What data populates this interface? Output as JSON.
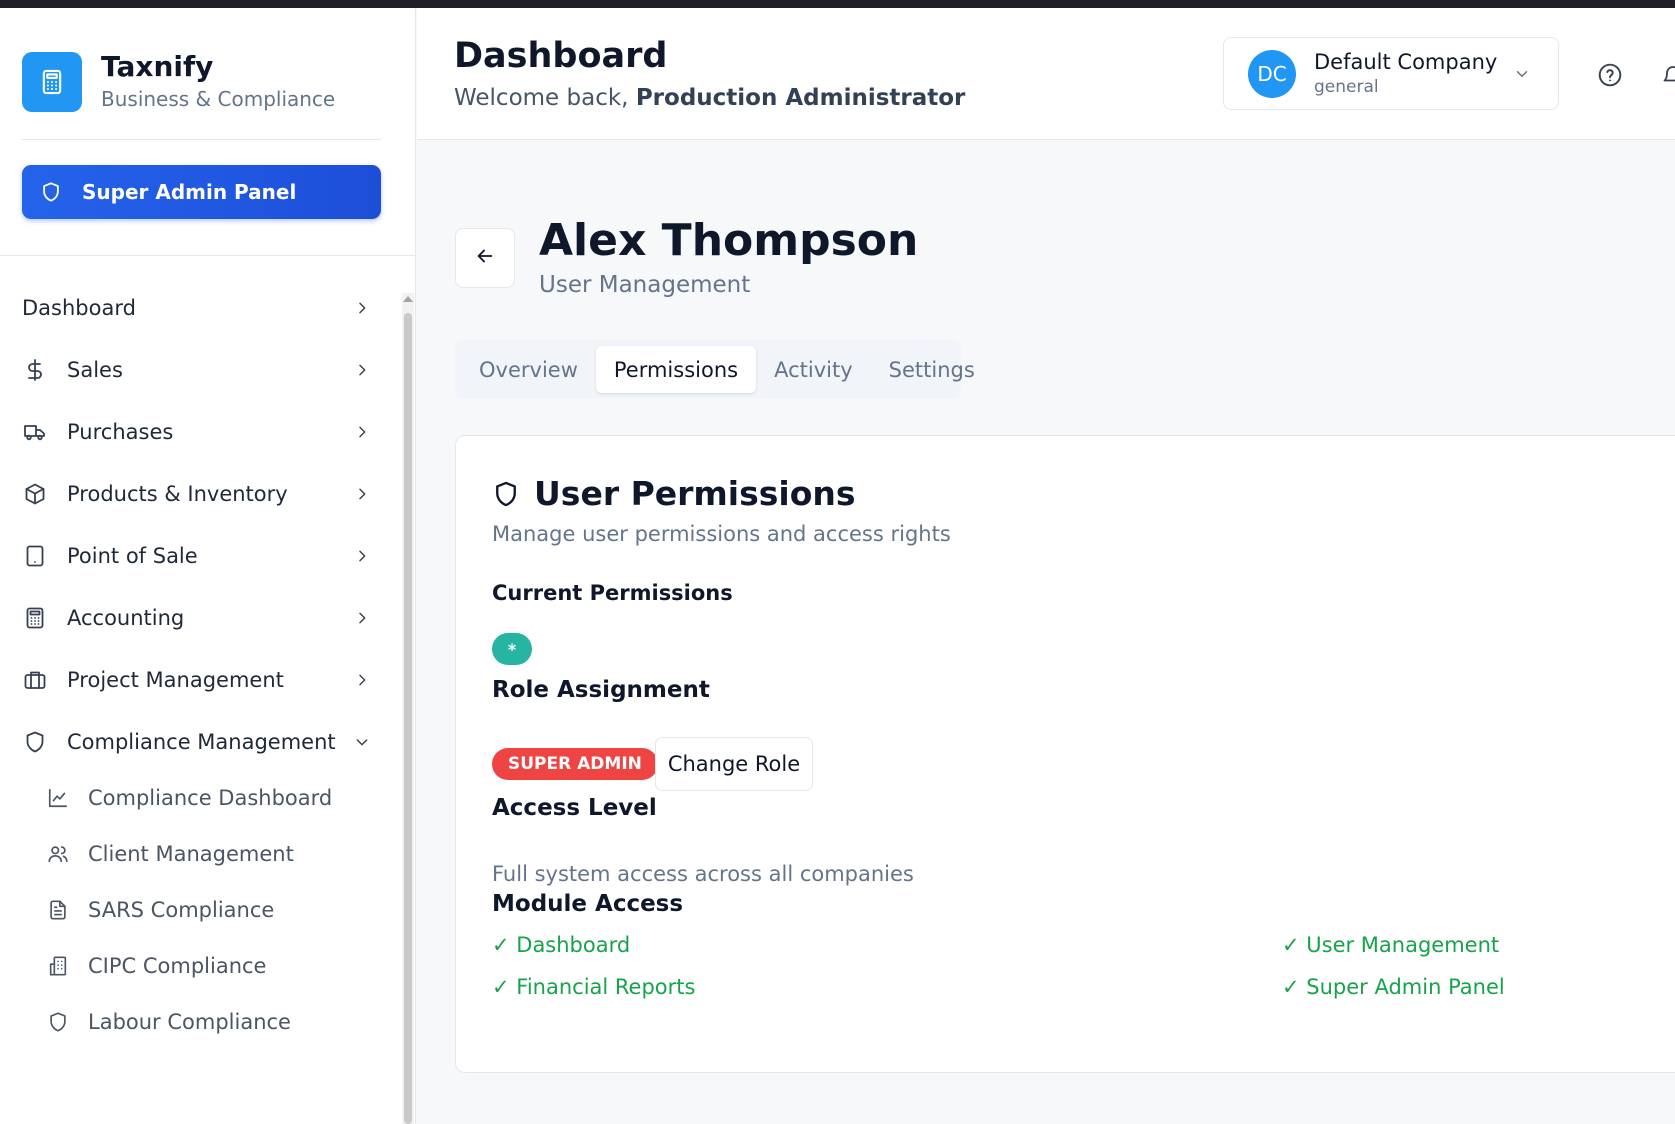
{
  "brand": {
    "name": "Taxnify",
    "subtitle": "Business & Compliance",
    "logo_icon": "calculator-icon"
  },
  "admin_button": {
    "label": "Super Admin Panel",
    "icon": "shield-icon"
  },
  "sidebar": {
    "items": [
      {
        "label": "Dashboard",
        "icon": ""
      },
      {
        "label": "Sales",
        "icon": "dollar-icon"
      },
      {
        "label": "Purchases",
        "icon": "truck-icon"
      },
      {
        "label": "Products & Inventory",
        "icon": "package-icon"
      },
      {
        "label": "Point of Sale",
        "icon": "tablet-icon"
      },
      {
        "label": "Accounting",
        "icon": "calculator-icon"
      },
      {
        "label": "Project Management",
        "icon": "briefcase-icon"
      },
      {
        "label": "Compliance Management",
        "icon": "shield-icon",
        "expanded": true
      }
    ],
    "sub_items": [
      {
        "label": "Compliance Dashboard",
        "icon": "chart-line-icon"
      },
      {
        "label": "Client Management",
        "icon": "users-icon"
      },
      {
        "label": "SARS Compliance",
        "icon": "file-text-icon"
      },
      {
        "label": "CIPC Compliance",
        "icon": "building-icon"
      },
      {
        "label": "Labour Compliance",
        "icon": "shield-icon"
      }
    ]
  },
  "header": {
    "title": "Dashboard",
    "welcome_prefix": "Welcome back, ",
    "user_name": "Production Administrator",
    "company": {
      "initials": "DC",
      "name": "Default Company",
      "type": "general"
    }
  },
  "profile": {
    "name": "Alex Thompson",
    "subtitle": "User Management"
  },
  "tabs": [
    {
      "label": "Overview",
      "active": false
    },
    {
      "label": "Permissions",
      "active": true
    },
    {
      "label": "Activity",
      "active": false
    },
    {
      "label": "Settings",
      "active": false
    }
  ],
  "permissions_card": {
    "title": "User Permissions",
    "subtitle": "Manage user permissions and access rights",
    "current_permissions_label": "Current Permissions",
    "current_permissions": [
      "*"
    ],
    "role_assignment_label": "Role Assignment",
    "role": "SUPER ADMIN",
    "change_role_label": "Change Role",
    "access_level_label": "Access Level",
    "access_level_desc": "Full system access across all companies",
    "module_access_label": "Module Access",
    "modules": [
      "✓ Dashboard",
      "✓ User Management",
      "✓ Financial Reports",
      "✓ Super Admin Panel"
    ]
  },
  "colors": {
    "accent": "#2563eb",
    "brand": "#2196f3",
    "success": "#16a34a",
    "danger": "#ef4444",
    "teal": "#26b5a2"
  }
}
